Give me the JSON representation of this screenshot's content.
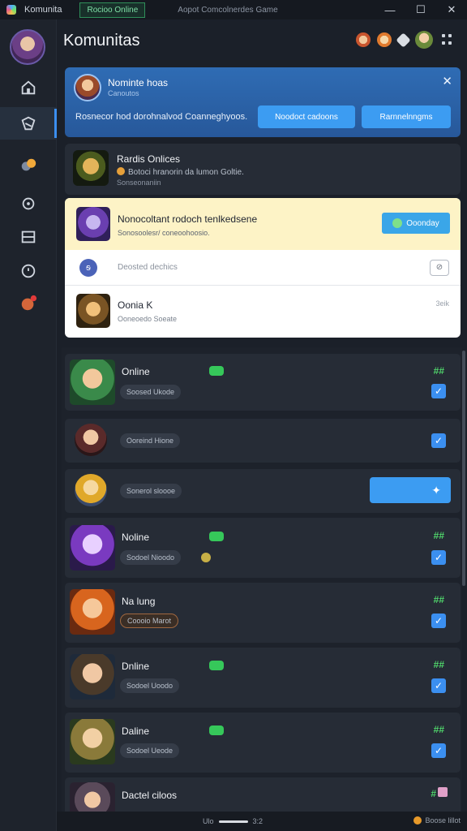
{
  "titlebar": {
    "app_name": "Komunita",
    "active_tab": "Rocioo Online",
    "window_title": "Aopot Comcolnerdes Game",
    "controls": [
      "minimize",
      "maximize",
      "close"
    ],
    "minimize_glyph": "—",
    "maximize_glyph": "☐",
    "close_glyph": "✕"
  },
  "sidebar": {
    "items": [
      {
        "icon": "home-icon"
      },
      {
        "icon": "community-icon"
      },
      {
        "icon": "friends-icon"
      },
      {
        "icon": "settings-gear-icon"
      },
      {
        "icon": "list-icon"
      },
      {
        "icon": "clock-icon"
      },
      {
        "icon": "notifications-avatar-icon"
      }
    ]
  },
  "header": {
    "title": "Komunitas",
    "icons": [
      "friend-avatar-icon",
      "friend-avatar-icon",
      "gift-icon",
      "profile-avatar-icon",
      "grid-menu-icon"
    ]
  },
  "notice": {
    "title": "Nominte hoas",
    "subtitle": "Canoutos",
    "message": "Rosnecor hod dorohnalvod Coanneghyoos.",
    "button_primary": "Noodoct cadoons",
    "button_secondary": "Rarnnelnngms",
    "close_glyph": "✕"
  },
  "featured": {
    "name": "Rardis Onlices",
    "line1": "Botoci hranorin da lumon Goltie.",
    "line2": "Sonseonaniin"
  },
  "panel": {
    "highlight_title": "Nonocoltant rodoch tenlkedsene",
    "highlight_sub": "Sonosoolesr/ coneoohoosio.",
    "highlight_button": "Ooonday",
    "row2_label": "Deosted dechics",
    "row2_icon_glyph": "ᵴ",
    "row2_checkbox_glyph": "⊘",
    "row3_name": "Oonia K",
    "row3_sub": "Ooneoedo Soeate",
    "row3_right": "3eik"
  },
  "list": {
    "rows": [
      {
        "name": "Online",
        "status": "Soosed Ukode",
        "badge": "##",
        "check": "✓"
      },
      {
        "name": "",
        "status": "Ooreind Hione",
        "check": "✓"
      },
      {
        "name": "",
        "status": "Sonerol sloooe",
        "button_glyph": "✦"
      },
      {
        "name": "Noline",
        "status": "Sodoel Nioodo",
        "badge": "##",
        "check": "✓"
      },
      {
        "name": "Na lung",
        "status": "Coooio Marot",
        "badge": "##",
        "check": "✓"
      },
      {
        "name": "Dnline",
        "status": "Sodoel Uoodo",
        "badge": "##",
        "check": "✓"
      },
      {
        "name": "Daline",
        "status": "Sodoel Ueode",
        "badge": "##",
        "check": "✓"
      },
      {
        "name": "Dactel ciloos",
        "badge": "#"
      }
    ]
  },
  "bottombar": {
    "pager_left": "Ulo",
    "pager_right": "3:2",
    "status": "Boose lillot"
  }
}
